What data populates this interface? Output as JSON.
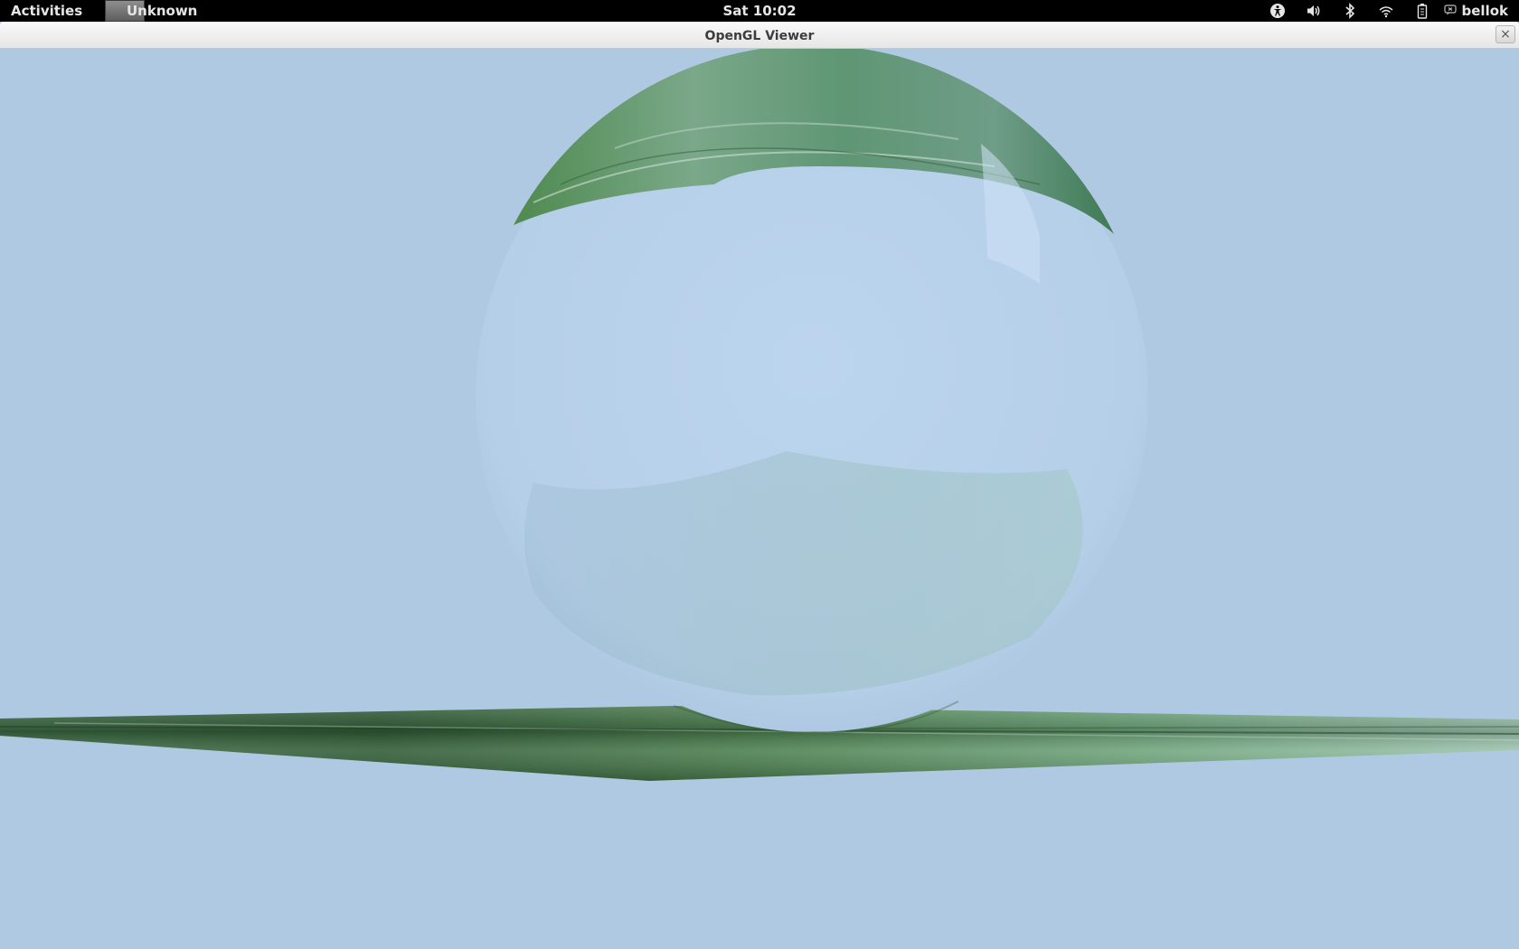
{
  "topbar": {
    "activities_label": "Activities",
    "app_menu_label": "Unknown",
    "clock": "Sat 10:02",
    "status_icons": [
      "accessibility-icon",
      "volume-icon",
      "bluetooth-icon",
      "wifi-icon",
      "battery-icon"
    ],
    "user_name": "bellok"
  },
  "window": {
    "title": "OpenGL Viewer",
    "close_glyph": "×"
  },
  "scene": {
    "objects": [
      "glass-sphere",
      "textured-ground-plane"
    ],
    "colors": {
      "sky": "#b0c9e2",
      "sphere_fill": "#b8d1ec",
      "ground_dark": "#2f5a35",
      "ground_mid": "#4f8a4f",
      "ground_light": "#a9c9b5"
    }
  }
}
